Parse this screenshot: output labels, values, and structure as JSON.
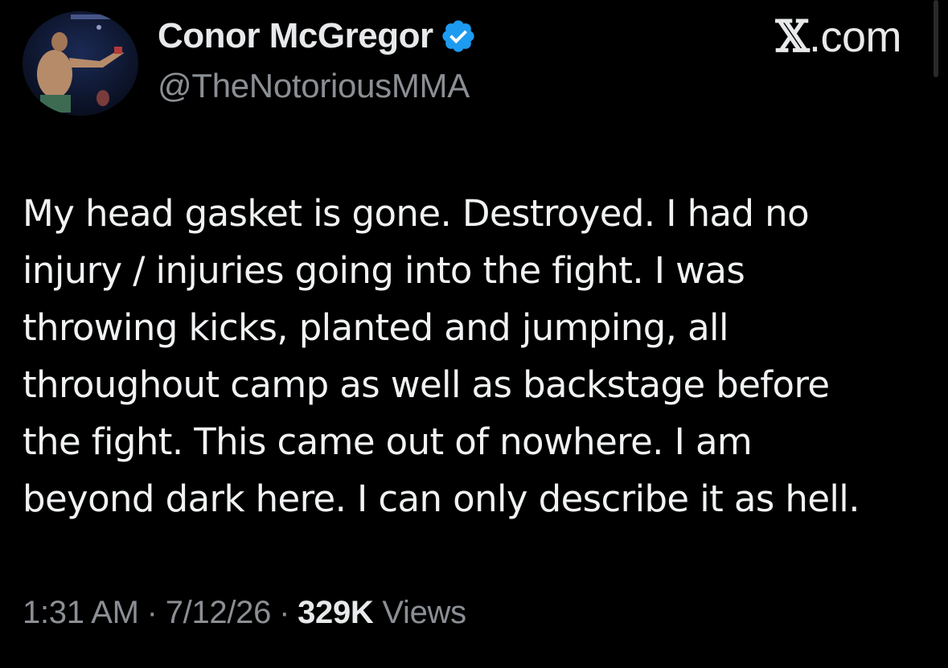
{
  "author": {
    "display_name": "Conor McGregor",
    "handle": "@TheNotoriousMMA",
    "verified": true,
    "avatar_icon": "profile-photo"
  },
  "brand": {
    "label": ".com",
    "x_glyph": "𝕏"
  },
  "tweet": {
    "lines": [
      "My head gasket is gone. Destroyed. I had no",
      "injury / injuries going into the fight. I was",
      "throwing kicks, planted and jumping, all",
      "throughout camp as well as backstage before",
      "the fight. This came out of nowhere. I am",
      "beyond dark here. I can only describe it as hell."
    ]
  },
  "meta": {
    "time": "1:31 AM",
    "date": "7/12/26",
    "separator": "·",
    "views_count": "329K",
    "views_label": "Views"
  },
  "colors": {
    "background": "#000000",
    "text_primary": "#e7e9ea",
    "text_secondary": "#8b8f94",
    "verified_badge": "#1d9bf0"
  }
}
